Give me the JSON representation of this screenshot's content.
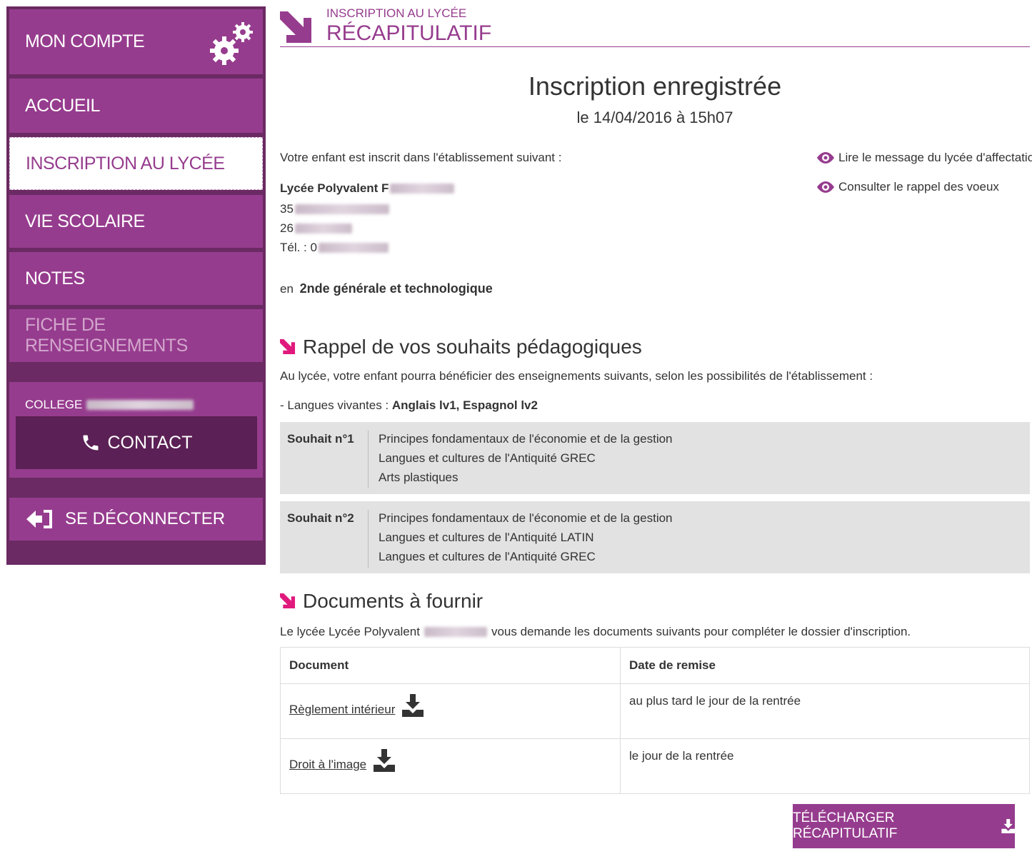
{
  "sidebar": {
    "account_label": "MON COMPTE",
    "items": [
      {
        "label": "ACCUEIL"
      },
      {
        "label": "INSCRIPTION AU LYCÉE"
      },
      {
        "label": "VIE SCOLAIRE"
      },
      {
        "label": "NOTES"
      },
      {
        "label": "FICHE DE RENSEIGNEMENTS"
      }
    ],
    "college_label": "COLLEGE",
    "contact_label": "CONTACT",
    "logout_label": "SE DÉCONNECTER"
  },
  "header": {
    "section": "INSCRIPTION AU LYCÉE",
    "title": "RÉCAPITULATIF"
  },
  "summary": {
    "title": "Inscription enregistrée",
    "date": "le 14/04/2016 à 15h07",
    "intro": "Votre enfant est inscrit dans l'établissement suivant :",
    "school_name": "Lycée Polyvalent F",
    "address_line1": "35",
    "address_line2": "26",
    "phone_label": "Tél. : 0",
    "level_prefix": "en",
    "level": "2nde générale et technologique",
    "link_message": "Lire le message du lycée d'affectation",
    "link_wishes": "Consulter le rappel des voeux"
  },
  "wishes_section": {
    "title": "Rappel de vos souhaits pédagogiques",
    "intro": "Au lycée, votre enfant pourra bénéficier des enseignements suivants, selon les possibilités de l'établissement :",
    "languages_label": "- Langues vivantes :",
    "languages_value": "Anglais lv1, Espagnol lv2",
    "wishes": [
      {
        "label": "Souhait n°1",
        "items": [
          "Principes fondamentaux de l'économie et de la gestion",
          "Langues et cultures de l'Antiquité GREC",
          "Arts plastiques"
        ]
      },
      {
        "label": "Souhait n°2",
        "items": [
          "Principes fondamentaux de l'économie et de la gestion",
          "Langues et cultures de l'Antiquité LATIN",
          "Langues et cultures de l'Antiquité GREC"
        ]
      }
    ]
  },
  "documents_section": {
    "title": "Documents à fournir",
    "intro_prefix": "Le lycée Lycée Polyvalent",
    "intro_suffix": "vous demande les documents suivants pour compléter le dossier d'inscription.",
    "columns": [
      "Document",
      "Date de remise"
    ],
    "rows": [
      {
        "document": "Règlement intérieur",
        "date": "au plus tard le jour de la rentrée"
      },
      {
        "document": "Droit à l'image",
        "date": "le jour de la rentrée"
      }
    ]
  },
  "download_button": "TÉLÉCHARGER RÉCAPITULATIF",
  "colors": {
    "brand": "#963c8e",
    "sidebar_bg": "#6b2a63",
    "contact_bg": "#5b2055",
    "accent": "#e0197d"
  }
}
